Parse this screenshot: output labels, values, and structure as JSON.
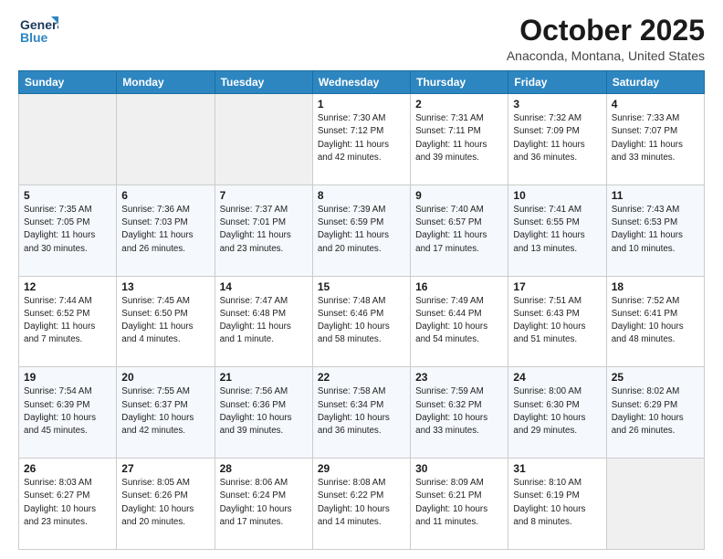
{
  "header": {
    "logo_line1": "General",
    "logo_line2": "Blue",
    "month": "October 2025",
    "location": "Anaconda, Montana, United States"
  },
  "weekdays": [
    "Sunday",
    "Monday",
    "Tuesday",
    "Wednesday",
    "Thursday",
    "Friday",
    "Saturday"
  ],
  "weeks": [
    [
      {
        "day": "",
        "info": ""
      },
      {
        "day": "",
        "info": ""
      },
      {
        "day": "",
        "info": ""
      },
      {
        "day": "1",
        "info": "Sunrise: 7:30 AM\nSunset: 7:12 PM\nDaylight: 11 hours\nand 42 minutes."
      },
      {
        "day": "2",
        "info": "Sunrise: 7:31 AM\nSunset: 7:11 PM\nDaylight: 11 hours\nand 39 minutes."
      },
      {
        "day": "3",
        "info": "Sunrise: 7:32 AM\nSunset: 7:09 PM\nDaylight: 11 hours\nand 36 minutes."
      },
      {
        "day": "4",
        "info": "Sunrise: 7:33 AM\nSunset: 7:07 PM\nDaylight: 11 hours\nand 33 minutes."
      }
    ],
    [
      {
        "day": "5",
        "info": "Sunrise: 7:35 AM\nSunset: 7:05 PM\nDaylight: 11 hours\nand 30 minutes."
      },
      {
        "day": "6",
        "info": "Sunrise: 7:36 AM\nSunset: 7:03 PM\nDaylight: 11 hours\nand 26 minutes."
      },
      {
        "day": "7",
        "info": "Sunrise: 7:37 AM\nSunset: 7:01 PM\nDaylight: 11 hours\nand 23 minutes."
      },
      {
        "day": "8",
        "info": "Sunrise: 7:39 AM\nSunset: 6:59 PM\nDaylight: 11 hours\nand 20 minutes."
      },
      {
        "day": "9",
        "info": "Sunrise: 7:40 AM\nSunset: 6:57 PM\nDaylight: 11 hours\nand 17 minutes."
      },
      {
        "day": "10",
        "info": "Sunrise: 7:41 AM\nSunset: 6:55 PM\nDaylight: 11 hours\nand 13 minutes."
      },
      {
        "day": "11",
        "info": "Sunrise: 7:43 AM\nSunset: 6:53 PM\nDaylight: 11 hours\nand 10 minutes."
      }
    ],
    [
      {
        "day": "12",
        "info": "Sunrise: 7:44 AM\nSunset: 6:52 PM\nDaylight: 11 hours\nand 7 minutes."
      },
      {
        "day": "13",
        "info": "Sunrise: 7:45 AM\nSunset: 6:50 PM\nDaylight: 11 hours\nand 4 minutes."
      },
      {
        "day": "14",
        "info": "Sunrise: 7:47 AM\nSunset: 6:48 PM\nDaylight: 11 hours\nand 1 minute."
      },
      {
        "day": "15",
        "info": "Sunrise: 7:48 AM\nSunset: 6:46 PM\nDaylight: 10 hours\nand 58 minutes."
      },
      {
        "day": "16",
        "info": "Sunrise: 7:49 AM\nSunset: 6:44 PM\nDaylight: 10 hours\nand 54 minutes."
      },
      {
        "day": "17",
        "info": "Sunrise: 7:51 AM\nSunset: 6:43 PM\nDaylight: 10 hours\nand 51 minutes."
      },
      {
        "day": "18",
        "info": "Sunrise: 7:52 AM\nSunset: 6:41 PM\nDaylight: 10 hours\nand 48 minutes."
      }
    ],
    [
      {
        "day": "19",
        "info": "Sunrise: 7:54 AM\nSunset: 6:39 PM\nDaylight: 10 hours\nand 45 minutes."
      },
      {
        "day": "20",
        "info": "Sunrise: 7:55 AM\nSunset: 6:37 PM\nDaylight: 10 hours\nand 42 minutes."
      },
      {
        "day": "21",
        "info": "Sunrise: 7:56 AM\nSunset: 6:36 PM\nDaylight: 10 hours\nand 39 minutes."
      },
      {
        "day": "22",
        "info": "Sunrise: 7:58 AM\nSunset: 6:34 PM\nDaylight: 10 hours\nand 36 minutes."
      },
      {
        "day": "23",
        "info": "Sunrise: 7:59 AM\nSunset: 6:32 PM\nDaylight: 10 hours\nand 33 minutes."
      },
      {
        "day": "24",
        "info": "Sunrise: 8:00 AM\nSunset: 6:30 PM\nDaylight: 10 hours\nand 29 minutes."
      },
      {
        "day": "25",
        "info": "Sunrise: 8:02 AM\nSunset: 6:29 PM\nDaylight: 10 hours\nand 26 minutes."
      }
    ],
    [
      {
        "day": "26",
        "info": "Sunrise: 8:03 AM\nSunset: 6:27 PM\nDaylight: 10 hours\nand 23 minutes."
      },
      {
        "day": "27",
        "info": "Sunrise: 8:05 AM\nSunset: 6:26 PM\nDaylight: 10 hours\nand 20 minutes."
      },
      {
        "day": "28",
        "info": "Sunrise: 8:06 AM\nSunset: 6:24 PM\nDaylight: 10 hours\nand 17 minutes."
      },
      {
        "day": "29",
        "info": "Sunrise: 8:08 AM\nSunset: 6:22 PM\nDaylight: 10 hours\nand 14 minutes."
      },
      {
        "day": "30",
        "info": "Sunrise: 8:09 AM\nSunset: 6:21 PM\nDaylight: 10 hours\nand 11 minutes."
      },
      {
        "day": "31",
        "info": "Sunrise: 8:10 AM\nSunset: 6:19 PM\nDaylight: 10 hours\nand 8 minutes."
      },
      {
        "day": "",
        "info": ""
      }
    ]
  ]
}
